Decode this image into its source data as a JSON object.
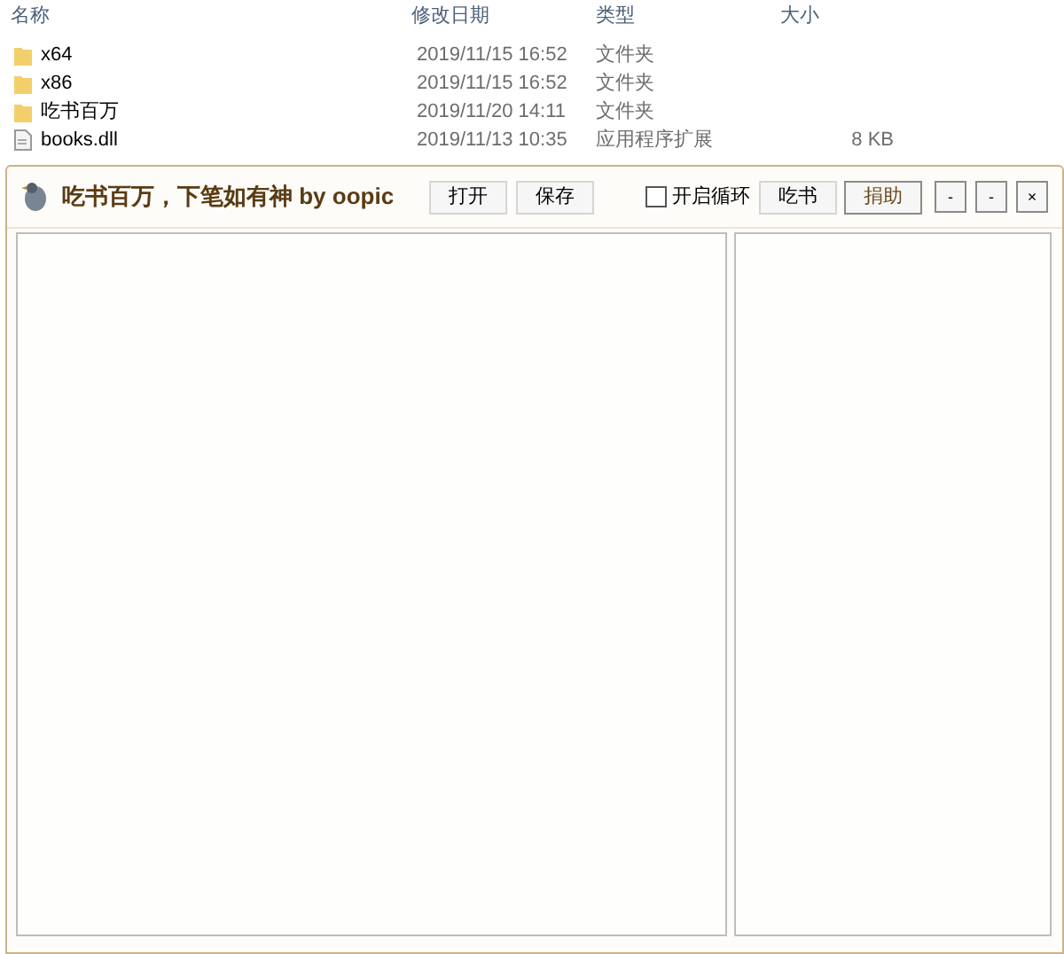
{
  "explorer": {
    "columns": [
      "名称",
      "修改日期",
      "类型",
      "大小"
    ],
    "rows": [
      {
        "kind": "folder",
        "name": "x64",
        "date": "2019/11/15 16:52",
        "type": "文件夹",
        "size": ""
      },
      {
        "kind": "folder",
        "name": "x86",
        "date": "2019/11/15 16:52",
        "type": "文件夹",
        "size": ""
      },
      {
        "kind": "folder",
        "name": "吃书百万",
        "date": "2019/11/20 14:11",
        "type": "文件夹",
        "size": ""
      },
      {
        "kind": "file",
        "name": "books.dll",
        "date": "2019/11/13 10:35",
        "type": "应用程序扩展",
        "size": "8 KB"
      }
    ]
  },
  "app": {
    "title": "吃书百万，下笔如有神 by oopic",
    "buttons": [
      "打开",
      "保存"
    ],
    "loop": {
      "label": "开启循环",
      "checked": false
    },
    "actions": [
      {
        "label": "吃书",
        "emphasized": false
      },
      {
        "label": "捐助",
        "emphasized": true
      }
    ],
    "window_controls": [
      "-",
      "-",
      "×"
    ]
  }
}
